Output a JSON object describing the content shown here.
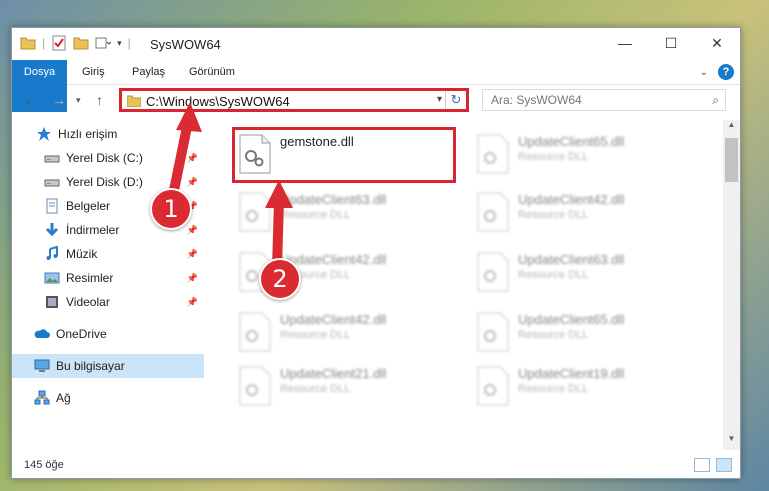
{
  "window": {
    "title": "SysWOW64",
    "controls": {
      "minimize": "—",
      "maximize": "☐",
      "close": "✕"
    }
  },
  "ribbon": {
    "tabs": [
      "Dosya",
      "Giriş",
      "Paylaş",
      "Görünüm"
    ],
    "accent": "#1979ca",
    "help": "?"
  },
  "address_bar": {
    "path": "C:\\Windows\\SysWOW64",
    "search_placeholder": "Ara: SysWOW64"
  },
  "sidebar": {
    "items": [
      {
        "label": "Hızlı erişim",
        "icon": "star-icon",
        "pinned": false
      },
      {
        "label": "Yerel Disk (C:)",
        "icon": "drive-icon",
        "pinned": true
      },
      {
        "label": "Yerel Disk (D:)",
        "icon": "drive-icon",
        "pinned": true
      },
      {
        "label": "Belgeler",
        "icon": "documents-icon",
        "pinned": true
      },
      {
        "label": "İndirmeler",
        "icon": "download-icon",
        "pinned": true
      },
      {
        "label": "Müzik",
        "icon": "music-icon",
        "pinned": true
      },
      {
        "label": "Resimler",
        "icon": "pictures-icon",
        "pinned": true
      },
      {
        "label": "Videolar",
        "icon": "videos-icon",
        "pinned": true
      },
      {
        "label": "OneDrive",
        "icon": "cloud-icon",
        "pinned": false
      },
      {
        "label": "Bu bilgisayar",
        "icon": "computer-icon",
        "pinned": false,
        "selected": true
      },
      {
        "label": "Ağ",
        "icon": "network-icon",
        "pinned": false
      }
    ]
  },
  "files": [
    {
      "name": "gemstone.dll",
      "type": ""
    },
    {
      "name": "UpdateClient65.dll",
      "type": "Resource DLL"
    },
    {
      "name": "UpdateClient63.dll",
      "type": "Resource DLL"
    },
    {
      "name": "UpdateClient42.dll",
      "type": "Resource DLL"
    },
    {
      "name": "UpdateClient42.dll",
      "type": "Resource DLL"
    },
    {
      "name": "UpdateClient63.dll",
      "type": "Resource DLL"
    },
    {
      "name": "UpdateClient42.dll",
      "type": "Resource DLL"
    },
    {
      "name": "UpdateClient65.dll",
      "type": "Resource DLL"
    },
    {
      "name": "UpdateClient21.dll",
      "type": "Resource DLL"
    },
    {
      "name": "UpdateClient19.dll",
      "type": "Resource DLL"
    }
  ],
  "status": {
    "item_count": "145 öğe"
  },
  "annotations": {
    "step1": "1",
    "step2": "2",
    "highlight_color": "#d9262e"
  }
}
